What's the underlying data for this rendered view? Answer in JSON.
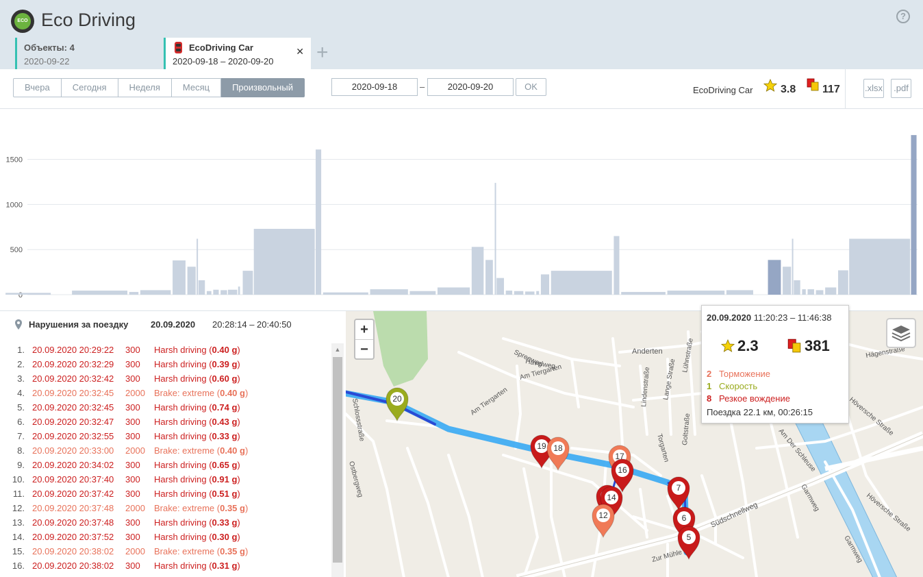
{
  "app": {
    "title": "Eco Driving",
    "logo_text": "ECO",
    "help": "?"
  },
  "tabs": [
    {
      "title": "Объекты: 4",
      "subtitle": "2020-09-22"
    },
    {
      "title": "EcoDriving Car",
      "subtitle": "2020-09-18  –  2020-09-20",
      "close": "✕"
    }
  ],
  "tab_add": "+",
  "toolbar": {
    "periods": [
      "Вчера",
      "Сегодня",
      "Неделя",
      "Месяц",
      "Произвольный"
    ],
    "active_period": "Произвольный",
    "date_from": "2020-09-18",
    "date_sep": "–",
    "date_to": "2020-09-20",
    "ok": "OK",
    "object_name": "EcoDriving Car",
    "rating": "3.8",
    "penalty": "117",
    "export_xlsx": ".xlsx",
    "export_pdf": ".pdf"
  },
  "chart_data": {
    "type": "bar",
    "ylim": [
      0,
      1900
    ],
    "yticks": [
      0,
      500,
      1000,
      1500
    ],
    "bars": [
      {
        "x0": 0.006,
        "x1": 0.055,
        "v": 20
      },
      {
        "x0": 0.078,
        "x1": 0.138,
        "v": 45
      },
      {
        "x0": 0.14,
        "x1": 0.15,
        "v": 30
      },
      {
        "x0": 0.152,
        "x1": 0.185,
        "v": 50
      },
      {
        "x0": 0.187,
        "x1": 0.201,
        "v": 380
      },
      {
        "x0": 0.203,
        "x1": 0.212,
        "v": 310
      },
      {
        "x0": 0.213,
        "x1": 0.214,
        "v": 620
      },
      {
        "x0": 0.215,
        "x1": 0.222,
        "v": 160
      },
      {
        "x0": 0.224,
        "x1": 0.229,
        "v": 40
      },
      {
        "x0": 0.231,
        "x1": 0.237,
        "v": 55
      },
      {
        "x0": 0.239,
        "x1": 0.246,
        "v": 50
      },
      {
        "x0": 0.247,
        "x1": 0.257,
        "v": 55
      },
      {
        "x0": 0.258,
        "x1": 0.26,
        "v": 90
      },
      {
        "x0": 0.263,
        "x1": 0.274,
        "v": 265
      },
      {
        "x0": 0.275,
        "x1": 0.341,
        "v": 730
      },
      {
        "x0": 0.342,
        "x1": 0.348,
        "v": 1610
      },
      {
        "x0": 0.35,
        "x1": 0.399,
        "v": 25
      },
      {
        "x0": 0.401,
        "x1": 0.442,
        "v": 60
      },
      {
        "x0": 0.444,
        "x1": 0.472,
        "v": 40
      },
      {
        "x0": 0.474,
        "x1": 0.509,
        "v": 80
      },
      {
        "x0": 0.511,
        "x1": 0.524,
        "v": 530
      },
      {
        "x0": 0.526,
        "x1": 0.534,
        "v": 385
      },
      {
        "x0": 0.536,
        "x1": 0.536,
        "v": 1240
      },
      {
        "x0": 0.538,
        "x1": 0.546,
        "v": 185
      },
      {
        "x0": 0.548,
        "x1": 0.555,
        "v": 45
      },
      {
        "x0": 0.557,
        "x1": 0.567,
        "v": 40
      },
      {
        "x0": 0.569,
        "x1": 0.579,
        "v": 35
      },
      {
        "x0": 0.581,
        "x1": 0.584,
        "v": 40
      },
      {
        "x0": 0.586,
        "x1": 0.595,
        "v": 225
      },
      {
        "x0": 0.597,
        "x1": 0.663,
        "v": 265
      },
      {
        "x0": 0.665,
        "x1": 0.671,
        "v": 650
      },
      {
        "x0": 0.673,
        "x1": 0.721,
        "v": 30
      },
      {
        "x0": 0.723,
        "x1": 0.785,
        "v": 45
      },
      {
        "x0": 0.787,
        "x1": 0.816,
        "v": 50
      },
      {
        "x0": 0.832,
        "x1": 0.846,
        "v": 385
      },
      {
        "x0": 0.848,
        "x1": 0.857,
        "v": 310
      },
      {
        "x0": 0.858,
        "x1": 0.859,
        "v": 620
      },
      {
        "x0": 0.86,
        "x1": 0.867,
        "v": 160
      },
      {
        "x0": 0.869,
        "x1": 0.873,
        "v": 60
      },
      {
        "x0": 0.875,
        "x1": 0.882,
        "v": 60
      },
      {
        "x0": 0.884,
        "x1": 0.892,
        "v": 50
      },
      {
        "x0": 0.894,
        "x1": 0.906,
        "v": 80
      },
      {
        "x0": 0.908,
        "x1": 0.919,
        "v": 270
      },
      {
        "x0": 0.92,
        "x1": 0.986,
        "v": 620
      },
      {
        "x0": 0.987,
        "x1": 0.993,
        "v": 1770
      }
    ],
    "highlight": [
      0.832,
      0.846
    ]
  },
  "violations": {
    "title": "Нарушения за поездку",
    "date": "20.09.2020",
    "time": "20:28:14 – 20:40:50",
    "rows": [
      {
        "n": "1.",
        "when": "20.09.2020 20:29:22",
        "lim": "300",
        "type": "Harsh driving",
        "val": "0.40 g",
        "sev": "red"
      },
      {
        "n": "2.",
        "when": "20.09.2020 20:32:29",
        "lim": "300",
        "type": "Harsh driving",
        "val": "0.39 g",
        "sev": "red"
      },
      {
        "n": "3.",
        "when": "20.09.2020 20:32:42",
        "lim": "300",
        "type": "Harsh driving",
        "val": "0.60 g",
        "sev": "red"
      },
      {
        "n": "4.",
        "when": "20.09.2020 20:32:45",
        "lim": "2000",
        "type": "Brake: extreme",
        "val": "0.40 g",
        "sev": "orange"
      },
      {
        "n": "5.",
        "when": "20.09.2020 20:32:45",
        "lim": "300",
        "type": "Harsh driving",
        "val": "0.74 g",
        "sev": "red"
      },
      {
        "n": "6.",
        "when": "20.09.2020 20:32:47",
        "lim": "300",
        "type": "Harsh driving",
        "val": "0.43 g",
        "sev": "red"
      },
      {
        "n": "7.",
        "when": "20.09.2020 20:32:55",
        "lim": "300",
        "type": "Harsh driving",
        "val": "0.33 g",
        "sev": "red"
      },
      {
        "n": "8.",
        "when": "20.09.2020 20:33:00",
        "lim": "2000",
        "type": "Brake: extreme",
        "val": "0.40 g",
        "sev": "orange"
      },
      {
        "n": "9.",
        "when": "20.09.2020 20:34:02",
        "lim": "300",
        "type": "Harsh driving",
        "val": "0.65 g",
        "sev": "red"
      },
      {
        "n": "10.",
        "when": "20.09.2020 20:37:40",
        "lim": "300",
        "type": "Harsh driving",
        "val": "0.91 g",
        "sev": "red"
      },
      {
        "n": "11.",
        "when": "20.09.2020 20:37:42",
        "lim": "300",
        "type": "Harsh driving",
        "val": "0.51 g",
        "sev": "red"
      },
      {
        "n": "12.",
        "when": "20.09.2020 20:37:48",
        "lim": "2000",
        "type": "Brake: extreme",
        "val": "0.35 g",
        "sev": "orange"
      },
      {
        "n": "13.",
        "when": "20.09.2020 20:37:48",
        "lim": "300",
        "type": "Harsh driving",
        "val": "0.33 g",
        "sev": "red"
      },
      {
        "n": "14.",
        "when": "20.09.2020 20:37:52",
        "lim": "300",
        "type": "Harsh driving",
        "val": "0.30 g",
        "sev": "red"
      },
      {
        "n": "15.",
        "when": "20.09.2020 20:38:02",
        "lim": "2000",
        "type": "Brake: extreme",
        "val": "0.35 g",
        "sev": "orange"
      },
      {
        "n": "16.",
        "when": "20.09.2020 20:38:02",
        "lim": "300",
        "type": "Harsh driving",
        "val": "0.31 g",
        "sev": "red"
      }
    ]
  },
  "map": {
    "zoom_in": "+",
    "zoom_out": "−",
    "street_labels": [
      "Spreeweg",
      "Havelweg",
      "Am Tiergarten",
      "Am Tiergarten",
      "Anderten",
      "Lühnstraße",
      "Lange Straße",
      "Lindenstraße",
      "Goltstraße",
      "Torgarten",
      "Südschnellweg",
      "Zur Mühle",
      "Hägenstraße",
      "Höversche Straße",
      "Am Der Schleuse",
      "Garmweg",
      "Ostbergweg",
      "Schlossstraße",
      "Höversche Straße",
      "Garmweg"
    ],
    "markers": [
      {
        "label": "20",
        "color": "#9aab1e"
      },
      {
        "label": "19",
        "color": "#c81a1a"
      },
      {
        "label": "18",
        "color": "#f07a57"
      },
      {
        "label": "17",
        "color": "#f07a57"
      },
      {
        "label": "16",
        "color": "#c81a1a"
      },
      {
        "label": "13",
        "color": "#c81a1a"
      },
      {
        "label": "14",
        "color": "#c81a1a"
      },
      {
        "label": "12",
        "color": "#f07a57"
      },
      {
        "label": "7",
        "color": "#c81a1a"
      },
      {
        "label": "6",
        "color": "#c81a1a"
      },
      {
        "label": "5",
        "color": "#c81a1a"
      }
    ]
  },
  "trip": {
    "date": "20.09.2020",
    "time": "11:20:23 – 11:46:38",
    "rating": "2.3",
    "penalty": "381",
    "items": [
      {
        "n": "2",
        "label": "Торможение",
        "color": "#e8725a"
      },
      {
        "n": "1",
        "label": "Скорость",
        "color": "#9aab1e"
      },
      {
        "n": "8",
        "label": "Резкое вождение",
        "color": "#cc1f1f"
      }
    ],
    "summary": "Поездка 22.1 км, 00:26:15"
  }
}
